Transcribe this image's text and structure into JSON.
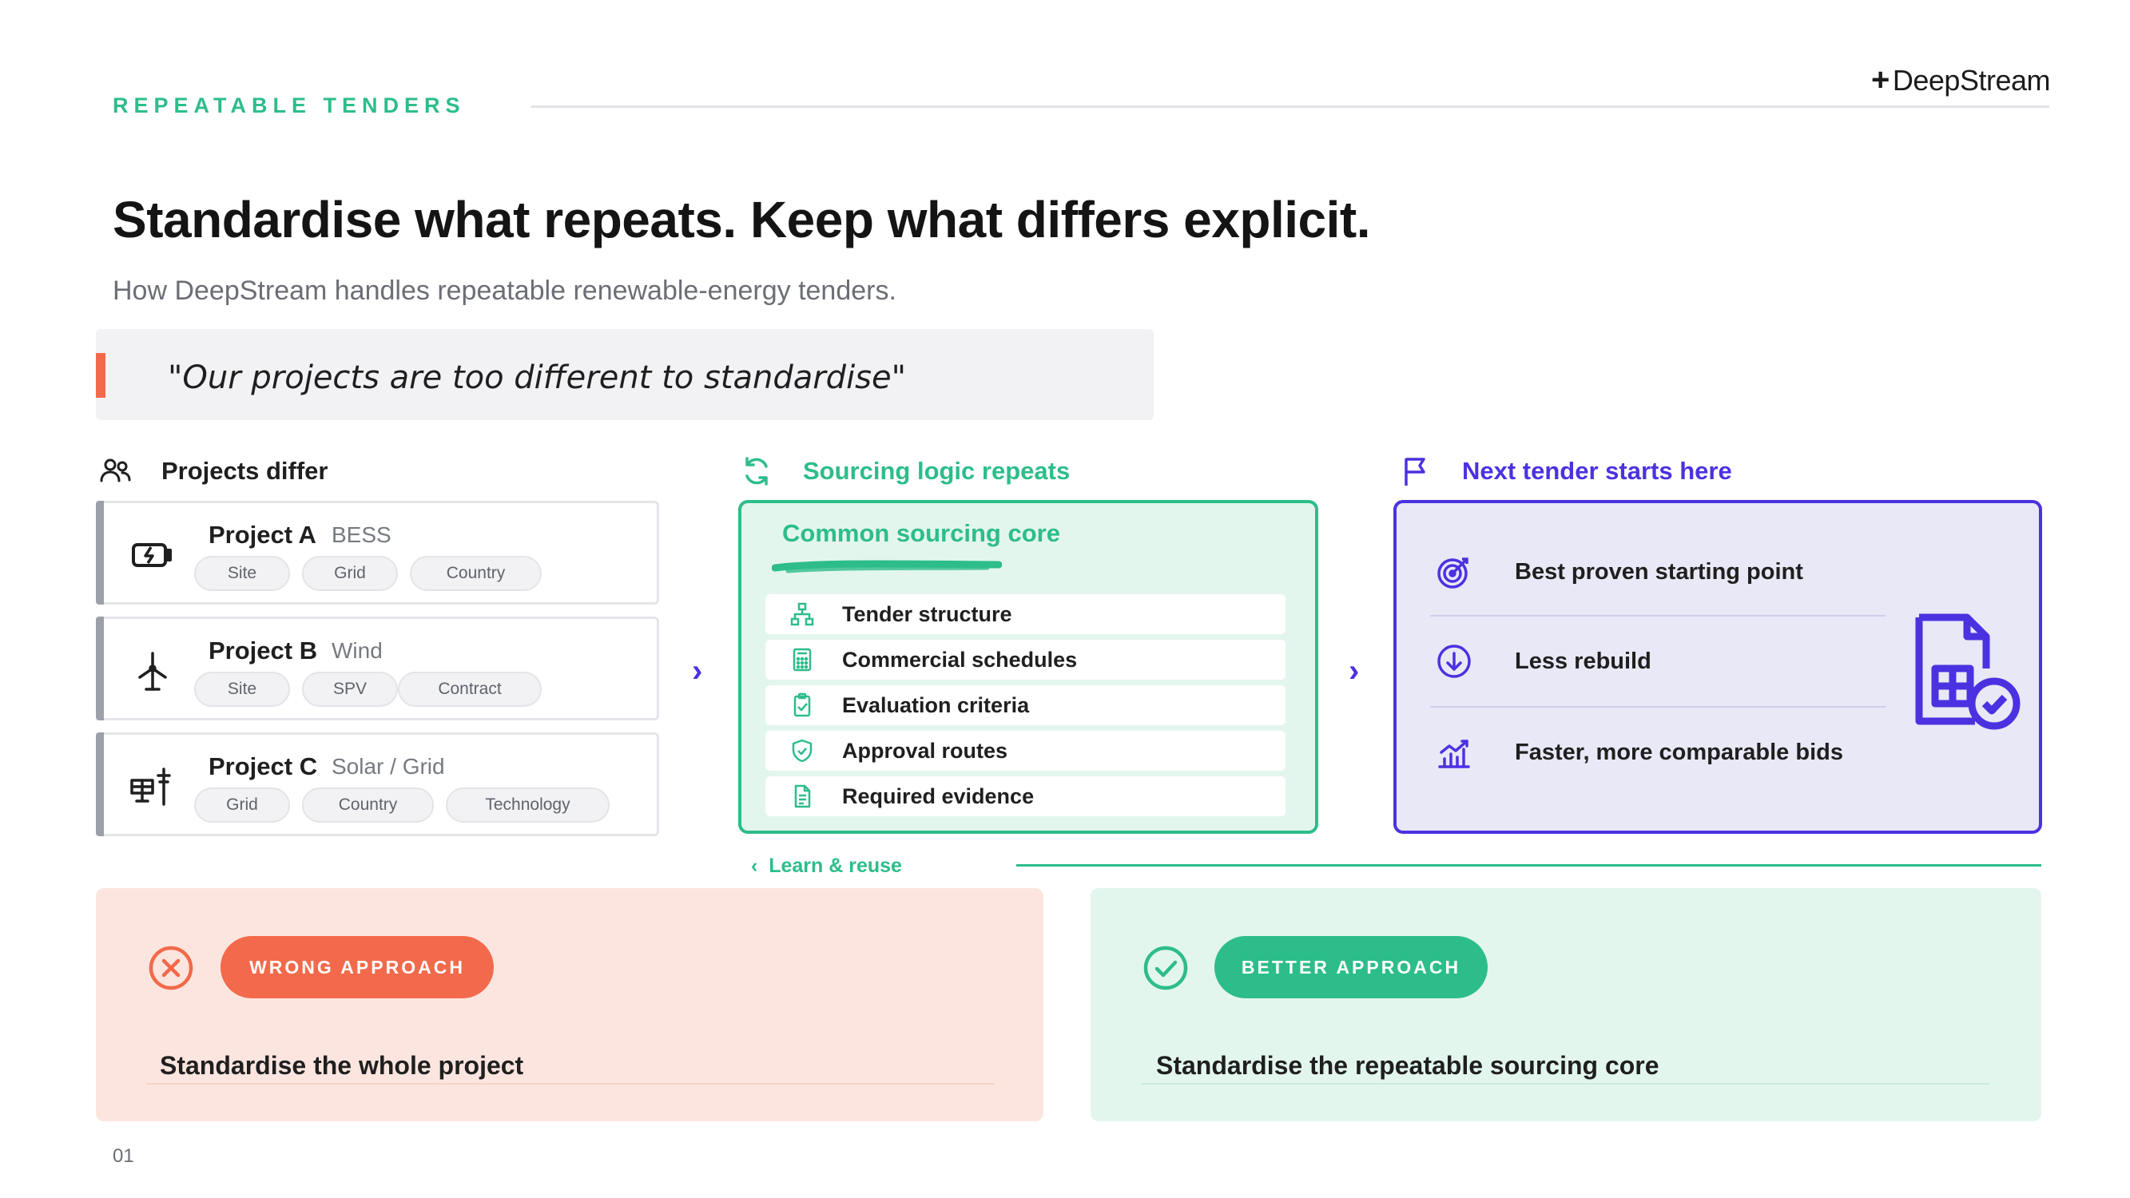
{
  "header": {
    "eyebrow": "REPEATABLE TENDERS",
    "logo": "DeepStream",
    "title": "Standardise what repeats. Keep what differs explicit.",
    "subtitle": "How DeepStream handles repeatable renewable-energy tenders."
  },
  "quote": "\"Our projects are too different to standardise\"",
  "sections": {
    "left": "Projects differ",
    "middle": "Sourcing logic repeats",
    "right": "Next tender starts here"
  },
  "projects": [
    {
      "name": "Project A",
      "type": "BESS",
      "icon": "battery-icon",
      "chips": [
        "Site",
        "Grid",
        "Country"
      ]
    },
    {
      "name": "Project B",
      "type": "Wind",
      "icon": "wind-turbine-icon",
      "chips": [
        "Site",
        "SPV",
        "Contract"
      ]
    },
    {
      "name": "Project C",
      "type": "Solar / Grid",
      "icon": "solar-grid-icon",
      "chips": [
        "Grid",
        "Country",
        "Technology"
      ]
    }
  ],
  "core": {
    "title": "Common sourcing core",
    "items": [
      {
        "label": "Tender structure",
        "icon": "hierarchy-icon"
      },
      {
        "label": "Commercial schedules",
        "icon": "calculator-icon"
      },
      {
        "label": "Evaluation criteria",
        "icon": "clipboard-check-icon"
      },
      {
        "label": "Approval routes",
        "icon": "shield-check-icon"
      },
      {
        "label": "Required evidence",
        "icon": "document-icon"
      }
    ]
  },
  "next": {
    "items": [
      {
        "label": "Best proven starting point",
        "icon": "target-icon"
      },
      {
        "label": "Less rebuild",
        "icon": "arrow-down-circle-icon"
      },
      {
        "label": "Faster, more comparable bids",
        "icon": "chart-up-icon"
      }
    ]
  },
  "learn": "Learn & reuse",
  "approaches": {
    "wrong": {
      "badge": "WRONG APPROACH",
      "text": "Standardise the whole project"
    },
    "better": {
      "badge": "BETTER APPROACH",
      "text": "Standardise the repeatable sourcing core"
    }
  },
  "page_number": "01",
  "colors": {
    "green": "#2dbd8a",
    "purple": "#4a32e0",
    "coral": "#f26a4b",
    "grey_bar": "#9ca0a8"
  }
}
